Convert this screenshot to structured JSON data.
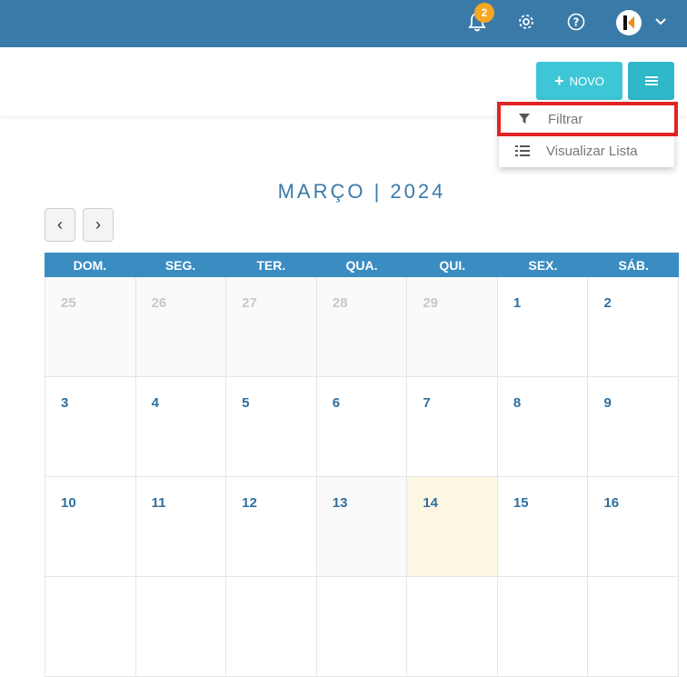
{
  "topbar": {
    "notification_count": "2",
    "icons": [
      "bell-icon",
      "gear-icon",
      "help-icon",
      "avatar",
      "chevron-down-icon"
    ],
    "color": "#3a7aa8"
  },
  "toolbar": {
    "novo_label": "NOVO",
    "novo_color": "#3ec6d6",
    "menu_color": "#2fb8c9"
  },
  "dropdown": {
    "items": [
      {
        "label": "Filtrar",
        "icon": "filter-icon"
      },
      {
        "label": "Visualizar Lista",
        "icon": "list-icon"
      }
    ]
  },
  "calendar": {
    "title": "MARÇO | 2024",
    "prev": "‹",
    "next": "›",
    "weekdays": [
      "DOM.",
      "SEG.",
      "TER.",
      "QUA.",
      "QUI.",
      "SEX.",
      "SÁB."
    ],
    "weeks": [
      [
        "25",
        "26",
        "27",
        "28",
        "29",
        "1",
        "2"
      ],
      [
        "3",
        "4",
        "5",
        "6",
        "7",
        "8",
        "9"
      ],
      [
        "10",
        "11",
        "12",
        "13",
        "14",
        "15",
        "16"
      ],
      [
        "",
        "",
        "",
        "",
        "",
        "",
        ""
      ]
    ],
    "today": "14",
    "header_color": "#3a8cc1",
    "highlight_color": "#e02424"
  }
}
